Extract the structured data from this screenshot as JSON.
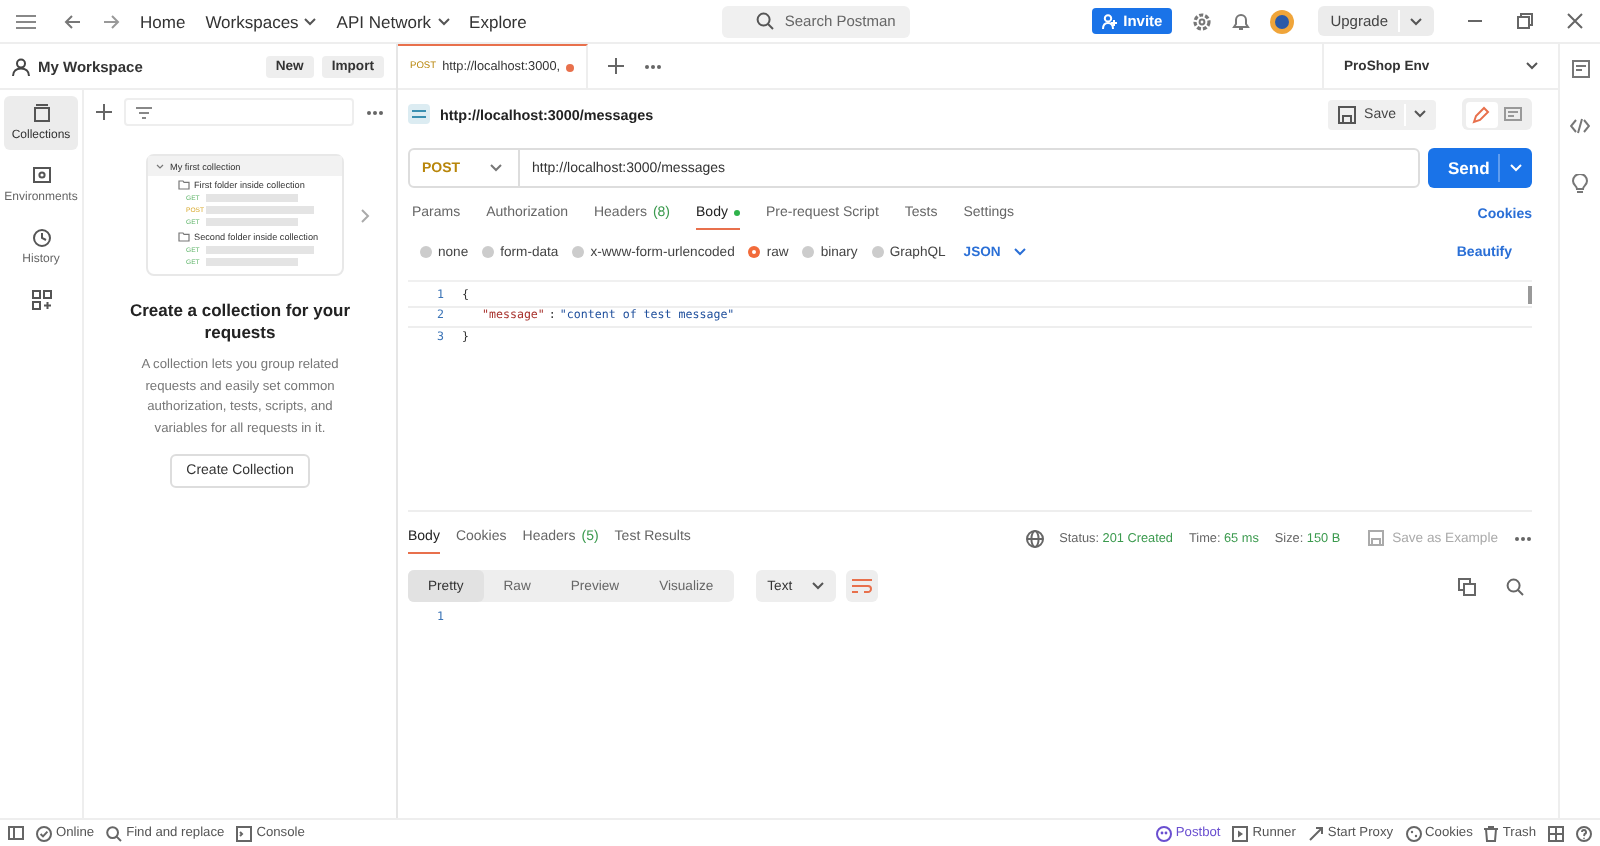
{
  "topbar": {
    "nav": [
      {
        "label": "Home",
        "dropdown": false
      },
      {
        "label": "Workspaces",
        "dropdown": true
      },
      {
        "label": "API Network",
        "dropdown": true
      },
      {
        "label": "Explore",
        "dropdown": false
      }
    ],
    "search": {
      "placeholder": "Search Postman"
    },
    "invite": "Invite",
    "upgrade": "Upgrade"
  },
  "workspace": {
    "title": "My Workspace",
    "buttons": [
      "New",
      "Import"
    ]
  },
  "rail": [
    {
      "kind": "collections",
      "label": "Collections",
      "selected": true
    },
    {
      "kind": "environments",
      "label": "Environments",
      "selected": false
    },
    {
      "kind": "history",
      "label": "History",
      "selected": false
    },
    {
      "kind": "apps",
      "selected": false
    }
  ],
  "illustration": {
    "collection": "My first collection",
    "folders": [
      {
        "name": "First folder inside collection",
        "requests": [
          "GET",
          "POST",
          "GET"
        ]
      },
      {
        "name": "Second folder inside collection",
        "requests": [
          "GET",
          "GET"
        ]
      }
    ]
  },
  "empty_state": {
    "title": "Create a collection for your requests",
    "text": "A collection lets you group related requests and easily set common authorization, tests, scripts, and variables for all requests in it.",
    "button": "Create Collection"
  },
  "request_tab": {
    "method": "POST",
    "url": "http://localhost:3000,",
    "unsaved": true
  },
  "environment": "ProShop Env",
  "request": {
    "title": "http://localhost:3000/messages",
    "method": "POST",
    "url": "http://localhost:3000/messages",
    "save": "Save",
    "send": "Send"
  },
  "request_tabs": [
    {
      "label": "Params",
      "selected": false
    },
    {
      "label": "Authorization",
      "selected": false
    },
    {
      "label": "Headers",
      "count": "(8)",
      "selected": false
    },
    {
      "label": "Body",
      "selected": true,
      "dot": true
    },
    {
      "label": "Pre-request Script",
      "selected": false
    },
    {
      "label": "Tests",
      "selected": false
    },
    {
      "label": "Settings",
      "selected": false
    }
  ],
  "cookies_link": "Cookies",
  "body_types": [
    {
      "label": "none",
      "selected": false
    },
    {
      "label": "form-data",
      "selected": false
    },
    {
      "label": "x-www-form-urlencoded",
      "selected": false
    },
    {
      "label": "raw",
      "selected": true
    },
    {
      "label": "binary",
      "selected": false
    },
    {
      "label": "GraphQL",
      "selected": false
    }
  ],
  "language": "JSON",
  "beautify": "Beautify",
  "code_lines": [
    {
      "number": "1",
      "tokens": [
        {
          "kind": "punct",
          "text": "{"
        }
      ]
    },
    {
      "number": "2",
      "tokens": [
        {
          "kind": "key",
          "text": "\"message\""
        },
        {
          "kind": "punct",
          "text": ":"
        },
        {
          "kind": "string",
          "text": "\"content of test message\""
        }
      ]
    },
    {
      "number": "3",
      "tokens": [
        {
          "kind": "punct",
          "text": "}"
        }
      ]
    }
  ],
  "response": {
    "tabs": [
      {
        "label": "Body",
        "selected": true
      },
      {
        "label": "Cookies",
        "selected": false
      },
      {
        "label": "Headers",
        "count": "(5)",
        "selected": false
      },
      {
        "label": "Test Results",
        "selected": false
      }
    ],
    "status_label": "Status:",
    "status": "201 Created",
    "time_label": "Time:",
    "time": "65 ms",
    "size_label": "Size:",
    "size": "150 B",
    "save_example": "Save as Example",
    "views": [
      {
        "label": "Pretty",
        "selected": true
      },
      {
        "label": "Raw",
        "selected": false
      },
      {
        "label": "Preview",
        "selected": false
      },
      {
        "label": "Visualize",
        "selected": false
      }
    ],
    "format": "Text",
    "lines": [
      "1"
    ]
  },
  "status_bar": {
    "left": [
      {
        "kind": "online",
        "label": "Online"
      },
      {
        "kind": "find",
        "label": "Find and replace"
      },
      {
        "kind": "console",
        "label": "Console"
      }
    ],
    "right": [
      {
        "kind": "postbot",
        "label": "Postbot"
      },
      {
        "kind": "runner",
        "label": "Runner"
      },
      {
        "kind": "proxy",
        "label": "Start Proxy"
      },
      {
        "kind": "cookies",
        "label": "Cookies"
      },
      {
        "kind": "trash",
        "label": "Trash"
      }
    ]
  }
}
